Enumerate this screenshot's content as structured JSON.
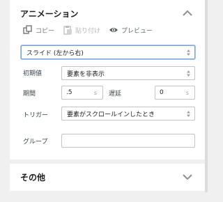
{
  "animation": {
    "title": "アニメーション",
    "toolbar": {
      "copy": "コピー",
      "paste": "貼り付け",
      "preview": "プレビュー"
    },
    "effect": "スライド (左から右)",
    "initial_state": {
      "label": "初期値",
      "value": "要素を非表示"
    },
    "duration": {
      "label": "期間",
      "value": ".5",
      "unit": "s"
    },
    "delay": {
      "label": "遅延",
      "value": "0",
      "unit": "s"
    },
    "trigger": {
      "label": "トリガー",
      "value": "要素がスクロールインしたとき"
    },
    "group": {
      "label": "グループ",
      "value": ""
    }
  },
  "other": {
    "title": "その他"
  },
  "icons": {
    "collapse": "chevron-up-icon",
    "expand": "chevron-down-icon",
    "copy": "copy-icon",
    "paste": "paste-icon",
    "preview": "eye-icon"
  }
}
